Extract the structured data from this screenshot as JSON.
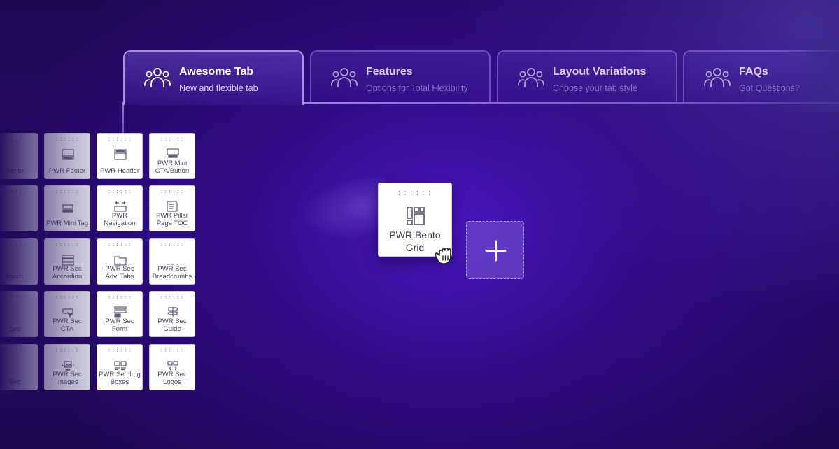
{
  "tabs": [
    {
      "title": "Awesome Tab",
      "subtitle": "New and flexible tab",
      "icon": "users-icon",
      "active": true
    },
    {
      "title": "Features",
      "subtitle": "Options for Total Flexibility",
      "icon": "users-icon",
      "active": false
    },
    {
      "title": "Layout Variations",
      "subtitle": "Choose your tab style",
      "icon": "users-icon",
      "active": false
    },
    {
      "title": "FAQs",
      "subtitle": "Got Questions?",
      "icon": "users-icon",
      "active": false
    }
  ],
  "widgets": {
    "partial_column": [
      "Bento",
      "",
      "earch",
      "Sec",
      "Sec"
    ],
    "grid": [
      [
        "PWR Footer",
        "PWR Header",
        "PWR Mini CTA/Button"
      ],
      [
        "PWR Mini Tag",
        "PWR Navigation",
        "PWR Pillar Page TOC"
      ],
      [
        "PWR Sec Accordion",
        "PWR Sec Adv. Tabs",
        "PWR Sec Breadcrumbs"
      ],
      [
        "PWR Sec CTA",
        "PWR Sec Form",
        "PWR Sec Guide"
      ],
      [
        "PWR Sec Images",
        "PWR Sec Img Boxes",
        "PWR Sec Logos"
      ]
    ]
  },
  "drag": {
    "label": "PWR Bento Grid",
    "icon": "bento-grid-icon",
    "drop_icon": "plus-icon",
    "cursor_icon": "grab-hand-icon"
  },
  "colors": {
    "background": "#240a66",
    "accent": "#7a5ad2",
    "card": "#ffffff"
  }
}
